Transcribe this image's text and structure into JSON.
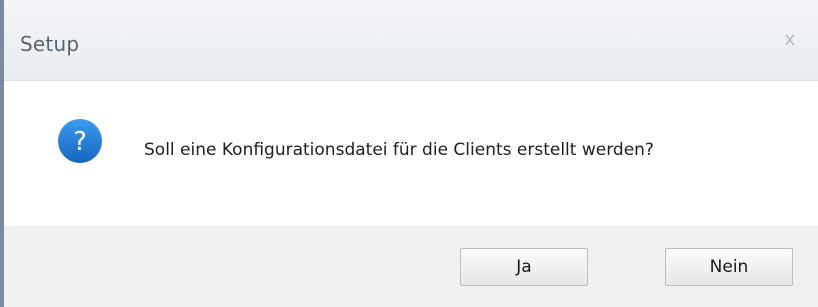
{
  "window": {
    "title": "Setup",
    "close_glyph": "x"
  },
  "dialog": {
    "icon": "question-icon",
    "icon_glyph": "?",
    "message": "Soll eine Konfigurationsdatei für die Clients erstellt werden?"
  },
  "buttons": {
    "yes_label": "Ja",
    "no_label": "Nein"
  },
  "colors": {
    "accent": "#1e7fd4",
    "title_text": "#566373",
    "footer_bg": "#f0f0f0"
  }
}
